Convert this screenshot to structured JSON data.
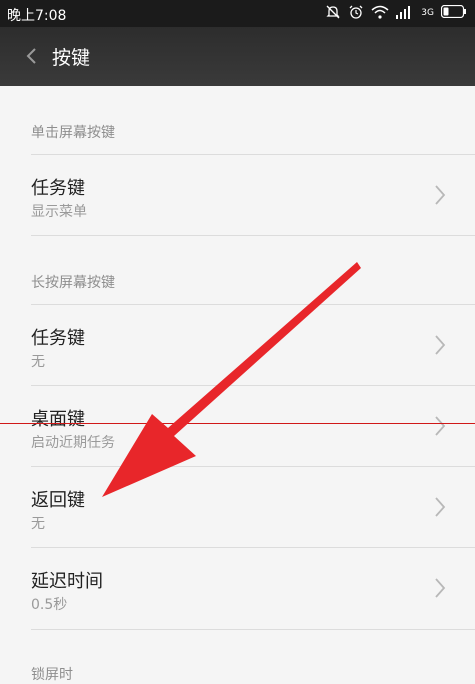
{
  "status_bar": {
    "time": "晚上7:08",
    "icons": [
      "mute-icon",
      "alarm-icon",
      "wifi-icon",
      "signal-icon",
      "network-type-icon",
      "battery-icon"
    ],
    "network_label": "3G"
  },
  "header": {
    "title": "按键"
  },
  "sections": [
    {
      "title": "单击屏幕按键",
      "items": [
        {
          "label": "任务键",
          "value": "显示菜单"
        }
      ]
    },
    {
      "title": "长按屏幕按键",
      "items": [
        {
          "label": "任务键",
          "value": "无"
        },
        {
          "label": "桌面键",
          "value": "启动近期任务"
        },
        {
          "label": "返回键",
          "value": "无"
        },
        {
          "label": "延迟时间",
          "value": "0.5秒"
        }
      ]
    },
    {
      "title": "锁屏时"
    }
  ],
  "colors": {
    "annotation_arrow": "#e8262a",
    "annotation_line": "#d01818",
    "header_bg": "#333333",
    "page_bg": "#f5f5f5"
  }
}
